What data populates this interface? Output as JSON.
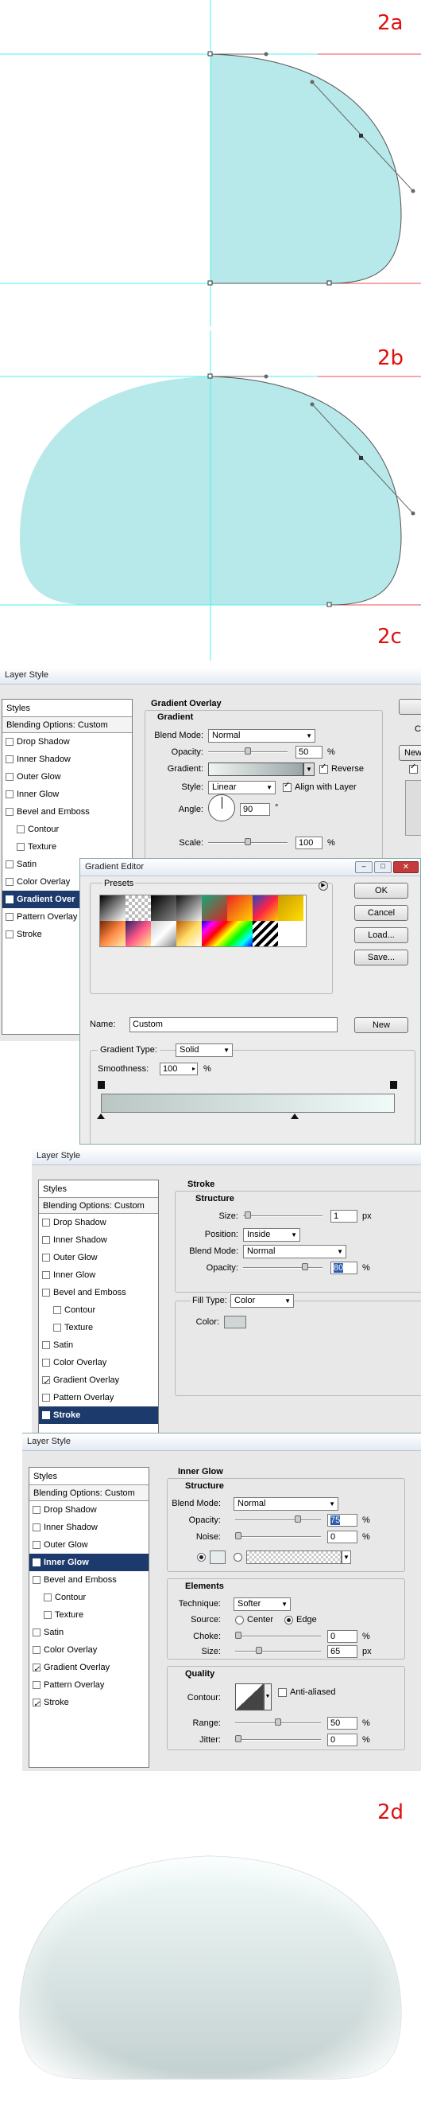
{
  "step_labels": {
    "a": "2a",
    "b": "2b",
    "c": "2c",
    "d": "2d"
  },
  "colors": {
    "shape_fill": "#b7e8ea",
    "guide": "#4ff0f0",
    "red_guide": "#e85050",
    "selection_blue": "#1c3a6b"
  },
  "style_list": {
    "header": "Styles",
    "blending": "Blending Options: Custom",
    "items": [
      "Drop Shadow",
      "Inner Shadow",
      "Outer Glow",
      "Inner Glow",
      "Bevel and Emboss",
      "Contour",
      "Texture",
      "Satin",
      "Color Overlay",
      "Gradient Overlay",
      "Pattern Overlay",
      "Stroke"
    ],
    "gradient_item_truncated": "Gradient Over"
  },
  "dialog1": {
    "title": "Layer Style",
    "section": "Gradient Overlay",
    "group": "Gradient",
    "blend_mode_label": "Blend Mode:",
    "blend_mode": "Normal",
    "opacity_label": "Opacity:",
    "opacity": "50",
    "pct": "%",
    "gradient_label": "Gradient:",
    "reverse": "Reverse",
    "style_label": "Style:",
    "style": "Linear",
    "align": "Align with Layer",
    "angle_label": "Angle:",
    "angle": "90",
    "deg": "°",
    "scale_label": "Scale:",
    "scale": "100",
    "btn_c": "C",
    "btn_new": "New"
  },
  "gradient_editor": {
    "title": "Gradient Editor",
    "presets": "Presets",
    "ok": "OK",
    "cancel": "Cancel",
    "load": "Load...",
    "save": "Save...",
    "name_label": "Name:",
    "name": "Custom",
    "new": "New",
    "type_label": "Gradient Type:",
    "type": "Solid",
    "smooth_label": "Smoothness:",
    "smooth": "100",
    "pct": "%"
  },
  "dialog2": {
    "title": "Layer Style",
    "section": "Stroke",
    "group": "Structure",
    "size_label": "Size:",
    "size": "1",
    "px": "px",
    "position_label": "Position:",
    "position": "Inside",
    "blend_label": "Blend Mode:",
    "blend": "Normal",
    "opacity_label": "Opacity:",
    "opacity": "80",
    "pct": "%",
    "fill_label": "Fill Type:",
    "fill": "Color",
    "color_label": "Color:"
  },
  "dialog3": {
    "title": "Layer Style",
    "section": "Inner Glow",
    "structure": "Structure",
    "blend_label": "Blend Mode:",
    "blend": "Normal",
    "opacity_label": "Opacity:",
    "opacity": "75",
    "noise_label": "Noise:",
    "noise": "0",
    "pct": "%",
    "elements": "Elements",
    "technique_label": "Technique:",
    "technique": "Softer",
    "source_label": "Source:",
    "center": "Center",
    "edge": "Edge",
    "choke_label": "Choke:",
    "choke": "0",
    "size_label": "Size:",
    "size": "65",
    "px": "px",
    "quality": "Quality",
    "contour_label": "Contour:",
    "antialias": "Anti-aliased",
    "range_label": "Range:",
    "range": "50",
    "jitter_label": "Jitter:",
    "jitter": "0"
  },
  "slider_levels": {
    "opacity1": 0.5,
    "scale1": 0.5,
    "size2": 0.02,
    "opacity2": 0.8,
    "opacity3": 0.75,
    "noise3": 0,
    "choke3": 0,
    "size3": 0.26,
    "range3": 0.5,
    "jitter3": 0
  }
}
